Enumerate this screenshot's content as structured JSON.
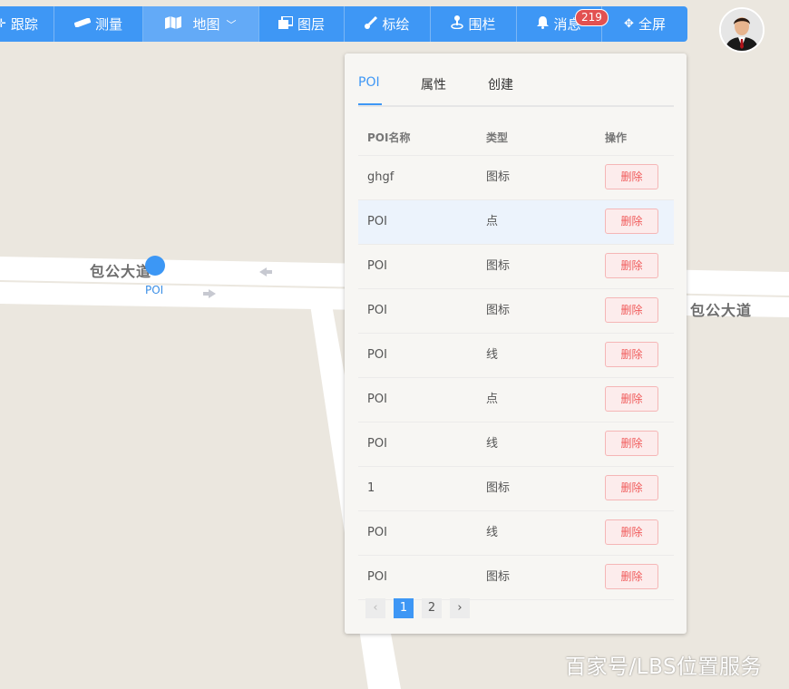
{
  "toolbar": {
    "items": [
      {
        "icon": "crosshair-icon",
        "label": "跟踪"
      },
      {
        "icon": "ruler-icon",
        "label": "测量"
      },
      {
        "icon": "map-icon",
        "label": "地图",
        "dropdown": true
      },
      {
        "icon": "layers-icon",
        "label": "图层"
      },
      {
        "icon": "brush-icon",
        "label": "标绘"
      },
      {
        "icon": "fence-icon",
        "label": "围栏"
      },
      {
        "icon": "bell-icon",
        "label": "消息",
        "badge": "219"
      },
      {
        "icon": "move-icon",
        "label": "全屏"
      }
    ],
    "active_index": 2
  },
  "map": {
    "road_label": "包公大道",
    "poi_label": "POI",
    "watermark": "百家号/LBS位置服务"
  },
  "panel": {
    "tabs": [
      "POI",
      "属性",
      "创建"
    ],
    "active_tab": 0,
    "columns": [
      "POI名称",
      "类型",
      "操作"
    ],
    "delete_label": "删除",
    "rows": [
      {
        "name": "ghgf",
        "type": "图标"
      },
      {
        "name": "POI",
        "type": "点",
        "highlighted": true
      },
      {
        "name": "POI",
        "type": "图标"
      },
      {
        "name": "POI",
        "type": "图标"
      },
      {
        "name": "POI",
        "type": "线"
      },
      {
        "name": "POI",
        "type": "点"
      },
      {
        "name": "POI",
        "type": "线"
      },
      {
        "name": "1",
        "type": "图标"
      },
      {
        "name": "POI",
        "type": "线"
      },
      {
        "name": "POI",
        "type": "图标"
      }
    ],
    "pagination": {
      "prev": "‹",
      "next": "›",
      "pages": [
        "1",
        "2"
      ],
      "current": "1"
    }
  },
  "colors": {
    "accent": "#3e97f5",
    "badge": "#e25151",
    "delete_text": "#f05a5a",
    "delete_border": "#f5b6b6"
  }
}
